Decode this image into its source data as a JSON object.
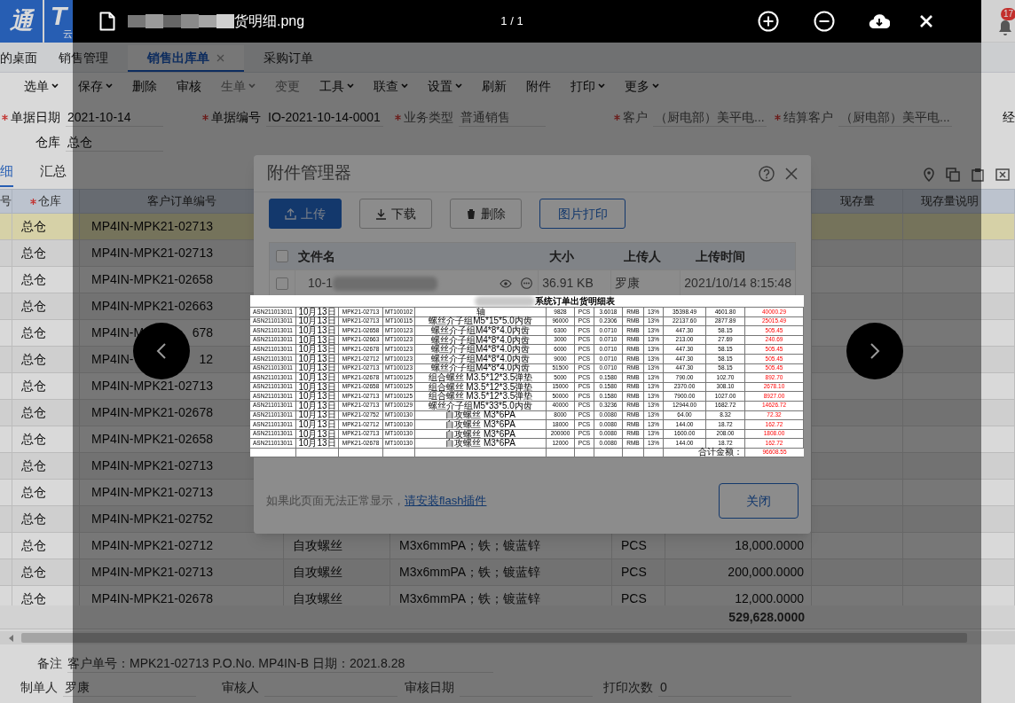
{
  "app": {
    "logo": {
      "mark": "通",
      "brand": "T",
      "brand_sub": "云"
    },
    "notification_count": "17",
    "tabs": [
      {
        "label": "的桌面",
        "selected": false,
        "closable": false
      },
      {
        "label": "销售管理",
        "selected": false,
        "closable": false
      },
      {
        "label": "销售出库单",
        "selected": true,
        "closable": true
      },
      {
        "label": "采购订单",
        "selected": false,
        "closable": false
      }
    ],
    "toolbar": [
      {
        "label": "选单",
        "dropdown": true,
        "disabled": false
      },
      {
        "label": "保存",
        "dropdown": true,
        "disabled": false
      },
      {
        "label": "删除",
        "dropdown": false,
        "disabled": false
      },
      {
        "label": "审核",
        "dropdown": false,
        "disabled": false
      },
      {
        "label": "生单",
        "dropdown": true,
        "disabled": true
      },
      {
        "label": "变更",
        "dropdown": false,
        "disabled": true
      },
      {
        "label": "工具",
        "dropdown": true,
        "disabled": false
      },
      {
        "label": "联查",
        "dropdown": true,
        "disabled": false
      },
      {
        "label": "设置",
        "dropdown": true,
        "disabled": false
      },
      {
        "label": "刷新",
        "dropdown": false,
        "disabled": false
      },
      {
        "label": "附件",
        "dropdown": false,
        "disabled": false
      },
      {
        "label": "打印",
        "dropdown": true,
        "disabled": false
      },
      {
        "label": "更多",
        "dropdown": true,
        "disabled": false
      }
    ],
    "form": [
      [
        {
          "label": "单据日期",
          "required": true,
          "disabled": false,
          "value": "2021-10-14"
        },
        {
          "label": "单据编号",
          "required": true,
          "disabled": false,
          "value": "IO-2021-10-14-0001"
        },
        {
          "label": "业务类型",
          "required": true,
          "disabled": true,
          "value": "普通销售"
        },
        {
          "label": "客户",
          "required": true,
          "disabled": true,
          "value": "（厨电部）美平电..."
        },
        {
          "label": "结算客户",
          "required": true,
          "disabled": true,
          "value": "（厨电部）美平电..."
        },
        {
          "label": "经",
          "required": false,
          "disabled": false
        }
      ],
      [
        {
          "label": "仓库",
          "required": false,
          "disabled": false,
          "value": "总仓"
        }
      ]
    ],
    "subtabs": [
      {
        "label": "细",
        "selected": true
      },
      {
        "label": "汇总",
        "selected": false
      }
    ],
    "table": {
      "columns": [
        {
          "label": "号",
          "required": false
        },
        {
          "label": "仓库",
          "required": true
        },
        {
          "label": "客户订单编号",
          "required": false
        },
        {
          "label": "现存量",
          "required": false
        },
        {
          "label": "现存量说明",
          "required": false
        }
      ],
      "rows": [
        {
          "warehouse": "总仓",
          "order_no": "MP4IN-MPK21-02713",
          "selected": true
        },
        {
          "warehouse": "总仓",
          "order_no": "MP4IN-MPK21-02713",
          "selected": false
        },
        {
          "warehouse": "总仓",
          "order_no": "MP4IN-MPK21-02658",
          "selected": false
        },
        {
          "warehouse": "总仓",
          "order_no": "MP4IN-MPK21-02663",
          "selected": false
        },
        {
          "warehouse": "总仓",
          "order_no": "MP4IN-M",
          "order_no_tail": "678",
          "selected": false
        },
        {
          "warehouse": "总仓",
          "order_no": "MP4IN-",
          "order_no_tail": "12",
          "selected": false
        },
        {
          "warehouse": "总仓",
          "order_no": "MP4IN-MPK21-02713",
          "selected": false
        },
        {
          "warehouse": "总仓",
          "order_no": "MP4IN-MPK21-02678",
          "selected": false
        },
        {
          "warehouse": "总仓",
          "order_no": "MP4IN-MPK21-02658",
          "selected": false
        },
        {
          "warehouse": "总仓",
          "order_no": "MP4IN-MPK21-02713",
          "selected": false
        },
        {
          "warehouse": "总仓",
          "order_no": "MP4IN-MPK21-02713",
          "selected": false
        },
        {
          "warehouse": "总仓",
          "order_no": "MP4IN-MPK21-02752",
          "selected": false
        },
        {
          "warehouse": "总仓",
          "order_no": "MP4IN-MPK21-02712",
          "column_4": "自攻螺丝",
          "column_5": "M3x6mmPA；铁；镀蓝锌",
          "column_6": "PCS",
          "column_7": "18,000.0000",
          "selected": false
        },
        {
          "warehouse": "总仓",
          "order_no": "MP4IN-MPK21-02713",
          "column_4": "自攻螺丝",
          "column_5": "M3x6mmPA；铁；镀蓝锌",
          "column_6": "PCS",
          "column_7": "200,000.0000",
          "selected": false
        },
        {
          "warehouse": "总仓",
          "order_no": "MP4IN-MPK21-02678",
          "column_4": "自攻螺丝",
          "column_5": "M3x6mmPA；铁；镀蓝锌",
          "column_6": "PCS",
          "column_7": "12,000.0000",
          "selected": false
        }
      ],
      "total": "529,628.0000"
    },
    "remark": {
      "label": "备注",
      "value": "客户单号：MPK21-02713 P.O.No. MP4IN-B 日期：2021.8.28"
    },
    "footer_fields": [
      {
        "label": "制单人",
        "value": "罗康"
      },
      {
        "label": "审核人"
      },
      {
        "label": "审核日期"
      },
      {
        "label": "打印次数",
        "value": "0"
      }
    ]
  },
  "dialog": {
    "title": "附件管理器",
    "buttons": [
      {
        "label": "上传",
        "kind": "primary"
      },
      {
        "label": "下载",
        "kind": "default"
      },
      {
        "label": "删除",
        "kind": "default"
      },
      {
        "label": "图片打印",
        "kind": "outline"
      }
    ],
    "files": {
      "columns": [
        "文件名",
        "大小",
        "上传人",
        "上传时间"
      ],
      "all_checked": false,
      "rows": [
        {
          "name": "10-1",
          "size": "36.91 KB",
          "uploader": "罗康",
          "time": "2021/10/14 8:15:48",
          "checked": false
        }
      ]
    },
    "notice": "如果此页面无法正常显示，",
    "notice_link": "请安装flash插件",
    "close_button": "关闭"
  },
  "viewer": {
    "file_name": "货明细.png",
    "counter": "1 / 1",
    "image": {
      "title": "系统订单出货明细表",
      "rows": [
        [
          "ASN211013011",
          "10月13日",
          "MPK21-02713",
          "MT100102",
          "轴",
          "9828",
          "PCS",
          "3.6018",
          "RMB",
          "13%",
          "35398.49",
          "4601.80",
          "40000.29"
        ],
        [
          "ASN211013011",
          "10月13日",
          "MPK21-02713",
          "MT100115",
          "螺丝介子组M5*15*5.0内齿",
          "96000",
          "PCS",
          "0.2306",
          "RMB",
          "13%",
          "22137.60",
          "2877.89",
          "25015.49"
        ],
        [
          "ASN211013011",
          "10月13日",
          "MPK21-02658",
          "MT100123",
          "螺丝介子组M4*8*4.0内齿",
          "6300",
          "PCS",
          "0.0710",
          "RMB",
          "13%",
          "447.30",
          "58.15",
          "505.45"
        ],
        [
          "ASN211013011",
          "10月13日",
          "MPK21-02663",
          "MT100123",
          "螺丝介子组M4*8*4.0内齿",
          "3000",
          "PCS",
          "0.0710",
          "RMB",
          "13%",
          "213.00",
          "27.69",
          "240.69"
        ],
        [
          "ASN211013011",
          "10月13日",
          "MPK21-02678",
          "MT100123",
          "螺丝介子组M4*8*4.0内齿",
          "6000",
          "PCS",
          "0.0710",
          "RMB",
          "13%",
          "447.30",
          "58.15",
          "505.45"
        ],
        [
          "ASN211013011",
          "10月13日",
          "MPK21-02712",
          "MT100123",
          "螺丝介子组M4*8*4.0内齿",
          "9000",
          "PCS",
          "0.0710",
          "RMB",
          "13%",
          "447.30",
          "58.15",
          "505.45"
        ],
        [
          "ASN211013011",
          "10月13日",
          "MPK21-02713",
          "MT100123",
          "螺丝介子组M4*8*4.0内齿",
          "51500",
          "PCS",
          "0.0710",
          "RMB",
          "13%",
          "447.30",
          "58.15",
          "505.45"
        ],
        [
          "ASN211013011",
          "10月13日",
          "MPK21-02678",
          "MT100125",
          "组合螺丝 M3.5*12*3.5弹垫",
          "5000",
          "PCS",
          "0.1580",
          "RMB",
          "13%",
          "790.00",
          "102.70",
          "892.70"
        ],
        [
          "ASN211013011",
          "10月13日",
          "MPK21-02658",
          "MT100125",
          "组合螺丝 M3.5*12*3.5弹垫",
          "15000",
          "PCS",
          "0.1580",
          "RMB",
          "13%",
          "2370.00",
          "308.10",
          "2678.10"
        ],
        [
          "ASN211013011",
          "10月13日",
          "MPK21-02713",
          "MT100125",
          "组合螺丝 M3.5*12*3.5弹垫",
          "50000",
          "PCS",
          "0.1580",
          "RMB",
          "13%",
          "7900.00",
          "1027.00",
          "8927.00"
        ],
        [
          "ASN211013011",
          "10月13日",
          "MPK21-02713",
          "MT100129",
          "螺丝介子组M5*33*5.0内齿",
          "40000",
          "PCS",
          "0.3236",
          "RMB",
          "13%",
          "12944.00",
          "1682.72",
          "14626.72"
        ],
        [
          "ASN211013011",
          "10月13日",
          "MPK21-02752",
          "MT100130",
          "自攻螺丝 M3*6PA",
          "8000",
          "PCS",
          "0.0080",
          "RMB",
          "13%",
          "64.00",
          "8.32",
          "72.32"
        ],
        [
          "ASN211013011",
          "10月13日",
          "MPK21-02712",
          "MT100130",
          "自攻螺丝 M3*6PA",
          "18000",
          "PCS",
          "0.0080",
          "RMB",
          "13%",
          "144.00",
          "18.72",
          "162.72"
        ],
        [
          "ASN211013011",
          "10月13日",
          "MPK21-02713",
          "MT100130",
          "自攻螺丝 M3*6PA",
          "200000",
          "PCS",
          "0.0080",
          "RMB",
          "13%",
          "1600.00",
          "208.00",
          "1808.00"
        ],
        [
          "ASN211013011",
          "10月13日",
          "MPK21-02678",
          "MT100130",
          "自攻螺丝 M3*6PA",
          "12000",
          "PCS",
          "0.0080",
          "RMB",
          "13%",
          "144.00",
          "18.72",
          "162.72"
        ]
      ],
      "total_label": "合计金额：",
      "total": "96608.55"
    }
  }
}
